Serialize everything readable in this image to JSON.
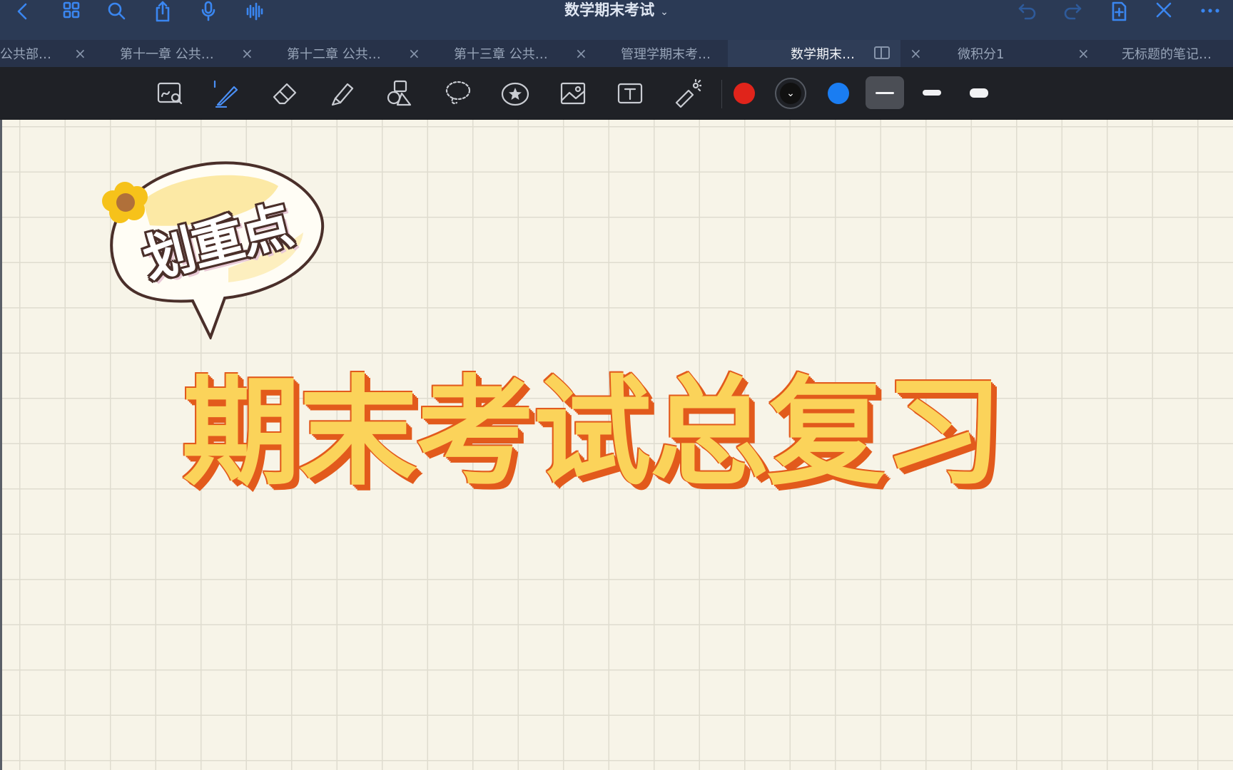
{
  "navbar": {
    "title": "数学期末考试",
    "title_chevron": "⌄",
    "left_buttons": [
      "back-icon",
      "grid-icon",
      "search-icon",
      "share-icon",
      "microphone-icon",
      "waveform-icon"
    ],
    "right_buttons": [
      "undo-icon",
      "redo-icon",
      "add-page-icon",
      "close-icon",
      "more-icon"
    ]
  },
  "tabs": [
    {
      "label": "公共部…",
      "close": "×"
    },
    {
      "label": "第十一章 公共…",
      "close": "×"
    },
    {
      "label": "第十二章 公共…",
      "close": "×"
    },
    {
      "label": "第十三章 公共…",
      "close": "×"
    },
    {
      "label": "管理学期末考…",
      "close": "×"
    },
    {
      "label": "数学期末…",
      "close": "×",
      "active": true
    },
    {
      "label": "微积分1",
      "close": "×"
    },
    {
      "label": "无标题的笔记…",
      "close": ""
    }
  ],
  "toolbar": {
    "tools": [
      "zoom-window-icon",
      "pen-icon",
      "eraser-icon",
      "highlighter-icon",
      "shapes-icon",
      "lasso-icon",
      "sticker-icon",
      "image-icon",
      "text-box-icon",
      "laser-pointer-icon"
    ],
    "active_tool": "pen-icon",
    "colors": [
      "#e0241b",
      "#111111",
      "#1a7df2"
    ],
    "selected_color": "#111111",
    "color_dropdown_glyph": "⌄",
    "stroke_widths": [
      "thin",
      "medium",
      "thick"
    ],
    "selected_stroke": "thin"
  },
  "canvas": {
    "sticker_text": "划重点",
    "headline": "期末考试总复习"
  }
}
